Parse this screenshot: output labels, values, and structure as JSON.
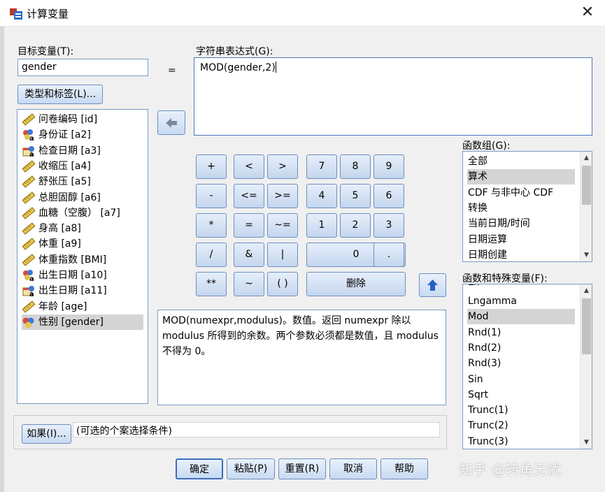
{
  "window": {
    "title": "计算变量",
    "close_glyph": "✕"
  },
  "target": {
    "label": "目标变量(T):",
    "value": "gender",
    "type_button": "类型和标签(L)..."
  },
  "equals": "=",
  "expression": {
    "label": "字符串表达式(G):",
    "value": "MOD(gender,2)"
  },
  "variables": [
    {
      "label": "问卷编码 [id]",
      "icon": "ruler-icon"
    },
    {
      "label": "身份证 [a2]",
      "icon": "nominal-a-icon"
    },
    {
      "label": "检查日期 [a3]",
      "icon": "date-icon"
    },
    {
      "label": "收缩压 [a4]",
      "icon": "ruler-icon"
    },
    {
      "label": "舒张压 [a5]",
      "icon": "ruler-icon"
    },
    {
      "label": "总胆固醇 [a6]",
      "icon": "ruler-icon"
    },
    {
      "label": "血糖（空腹） [a7]",
      "icon": "ruler-icon"
    },
    {
      "label": "身高 [a8]",
      "icon": "ruler-icon"
    },
    {
      "label": "体重 [a9]",
      "icon": "ruler-icon"
    },
    {
      "label": "体重指数 [BMI]",
      "icon": "ruler-icon"
    },
    {
      "label": "出生日期 [a10]",
      "icon": "nominal-a-icon"
    },
    {
      "label": "出生日期 [a11]",
      "icon": "date-icon"
    },
    {
      "label": "年龄 [age]",
      "icon": "ruler-icon"
    },
    {
      "label": "性别 [gender]",
      "icon": "nominal-icon"
    }
  ],
  "keypad": {
    "row1": [
      "+",
      "<",
      ">",
      "7",
      "8",
      "9"
    ],
    "row2": [
      "-",
      "<=",
      ">=",
      "4",
      "5",
      "6"
    ],
    "row3": [
      "*",
      "=",
      "~=",
      "1",
      "2",
      "3"
    ],
    "row4": [
      "/",
      "&",
      "|",
      "0",
      "."
    ],
    "row5": [
      "**",
      "~",
      "( )",
      "删除"
    ]
  },
  "description": "MOD(numexpr,modulus)。数值。返回 numexpr 除以 modulus 所得到的余数。两个参数必须都是数值，且 modulus 不得为 0。",
  "function_group": {
    "label": "函数组(G):",
    "items": [
      "全部",
      "算术",
      "CDF 与非中心 CDF",
      "转换",
      "当前日期/时间",
      "日期运算",
      "日期创建"
    ],
    "selected": "算术"
  },
  "functions": {
    "label": "函数和特殊变量(F):",
    "partial_top": "Ln",
    "items": [
      "Lngamma",
      "Mod",
      "Rnd(1)",
      "Rnd(2)",
      "Rnd(3)",
      "Sin",
      "Sqrt",
      "Trunc(1)",
      "Trunc(2)",
      "Trunc(3)"
    ],
    "selected": "Mod"
  },
  "if_condition": {
    "button": "如果(I)...",
    "text": "(可选的个案选择条件)"
  },
  "footer_buttons": {
    "ok": "确定",
    "paste": "粘贴(P)",
    "reset": "重置(R)",
    "cancel": "取消",
    "help": "帮助"
  },
  "watermark": "知乎 @转角无忧",
  "colors": {
    "field_border": "#7a9cc6",
    "button_border": "#6d8fbf",
    "selection": "#d4d4d4",
    "arrow_blue": "#2a5fc1"
  }
}
